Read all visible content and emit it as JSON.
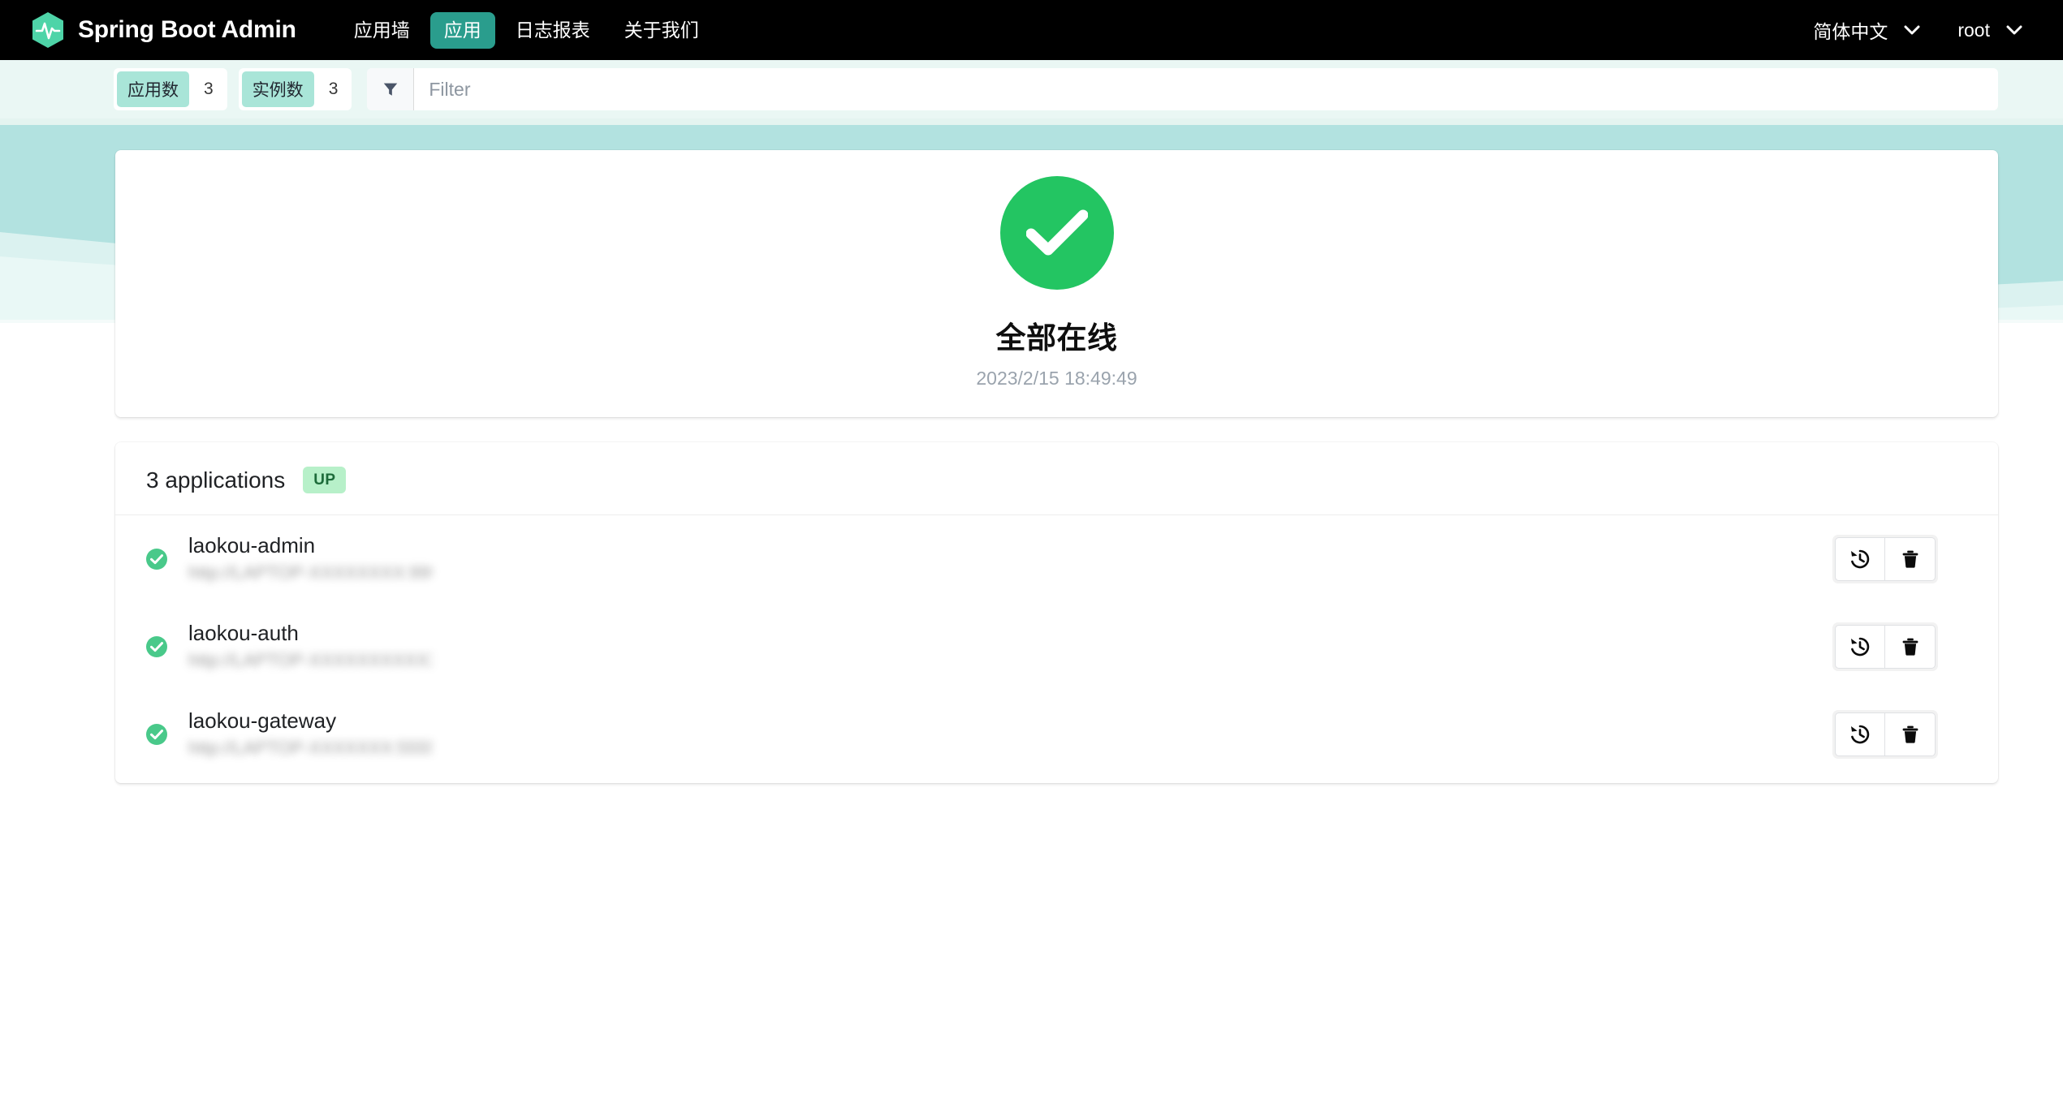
{
  "app": {
    "brand_title": "Spring Boot Admin",
    "logo_icon": "heartbeat-hexagon-logo",
    "accent_color": "#2a9d8d",
    "navbar_bg": "#000000",
    "status_green": "#23c562"
  },
  "nav": {
    "items": [
      {
        "label": "应用墙",
        "active": false,
        "name": "nav-item-applications-wall"
      },
      {
        "label": "应用",
        "active": true,
        "name": "nav-item-applications"
      },
      {
        "label": "日志报表",
        "active": false,
        "name": "nav-item-log-report"
      },
      {
        "label": "关于我们",
        "active": false,
        "name": "nav-item-about-us"
      }
    ],
    "language": {
      "label": "简体中文",
      "icon": "chevron-down-icon"
    },
    "user": {
      "label": "root",
      "icon": "chevron-down-icon"
    }
  },
  "filterbar": {
    "stats": [
      {
        "tag": "应用数",
        "value": "3"
      },
      {
        "tag": "实例数",
        "value": "3"
      }
    ],
    "filter_icon": "funnel-icon",
    "filter_placeholder": "Filter",
    "filter_value": ""
  },
  "status_card": {
    "icon": "check-circle-icon",
    "icon_color": "#23c562",
    "title": "全部在线",
    "timestamp": "2023/2/15 18:49:49"
  },
  "applications_card": {
    "header": {
      "count_label": "3 applications",
      "badge": "UP",
      "badge_bg": "#b7f0c9",
      "badge_color": "#1d6b3a"
    },
    "rows": [
      {
        "status_icon": "check-circle-icon",
        "name": "laokou-admin",
        "url": "http://LAPTOP-XXXXXXXX:9994/",
        "actions": [
          {
            "icon": "history-restore-icon",
            "name": "restore-button"
          },
          {
            "icon": "trash-icon",
            "name": "delete-button"
          }
        ]
      },
      {
        "status_icon": "check-circle-icon",
        "name": "laokou-auth",
        "url": "http://LAPTOP-XXXXXXXXXXX:1/",
        "actions": [
          {
            "icon": "history-restore-icon",
            "name": "restore-button"
          },
          {
            "icon": "trash-icon",
            "name": "delete-button"
          }
        ]
      },
      {
        "status_icon": "check-circle-icon",
        "name": "laokou-gateway",
        "url": "http://LAPTOP-XXXXXXX:5555/",
        "actions": [
          {
            "icon": "history-restore-icon",
            "name": "restore-button"
          },
          {
            "icon": "trash-icon",
            "name": "delete-button"
          }
        ]
      }
    ]
  }
}
